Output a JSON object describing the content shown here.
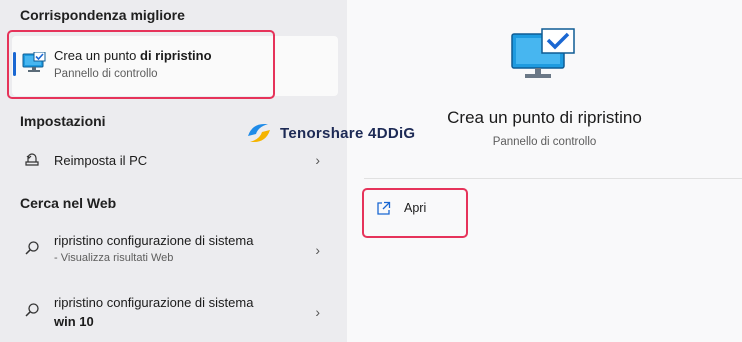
{
  "left": {
    "best_match_heading": "Corrispondenza migliore",
    "best_match": {
      "title_prefix": "Crea un punto ",
      "title_bold": "di ripristino",
      "subtitle": "Pannello di controllo",
      "icon": "monitor-check-icon"
    },
    "settings_heading": "Impostazioni",
    "settings_items": [
      {
        "label": "Reimposta il PC",
        "icon": "reset-pc-icon"
      }
    ],
    "web_heading": "Cerca nel Web",
    "web_items": [
      {
        "label": "ripristino configurazione di sistema",
        "sub": "- Visualizza risultati Web",
        "icon": "search-icon"
      },
      {
        "label": "ripristino configurazione di sistema",
        "sub": "win 10",
        "icon": "search-icon"
      }
    ]
  },
  "watermark": {
    "text": "Tenorshare 4DDiG",
    "icon": "tenorshare-logo"
  },
  "right": {
    "title": "Crea un punto di ripristino",
    "subtitle": "Pannello di controllo",
    "open_label": "Apri",
    "icon": "monitor-check-icon"
  },
  "colors": {
    "accent": "#1a67d2",
    "highlight_box": "#e6335a"
  }
}
